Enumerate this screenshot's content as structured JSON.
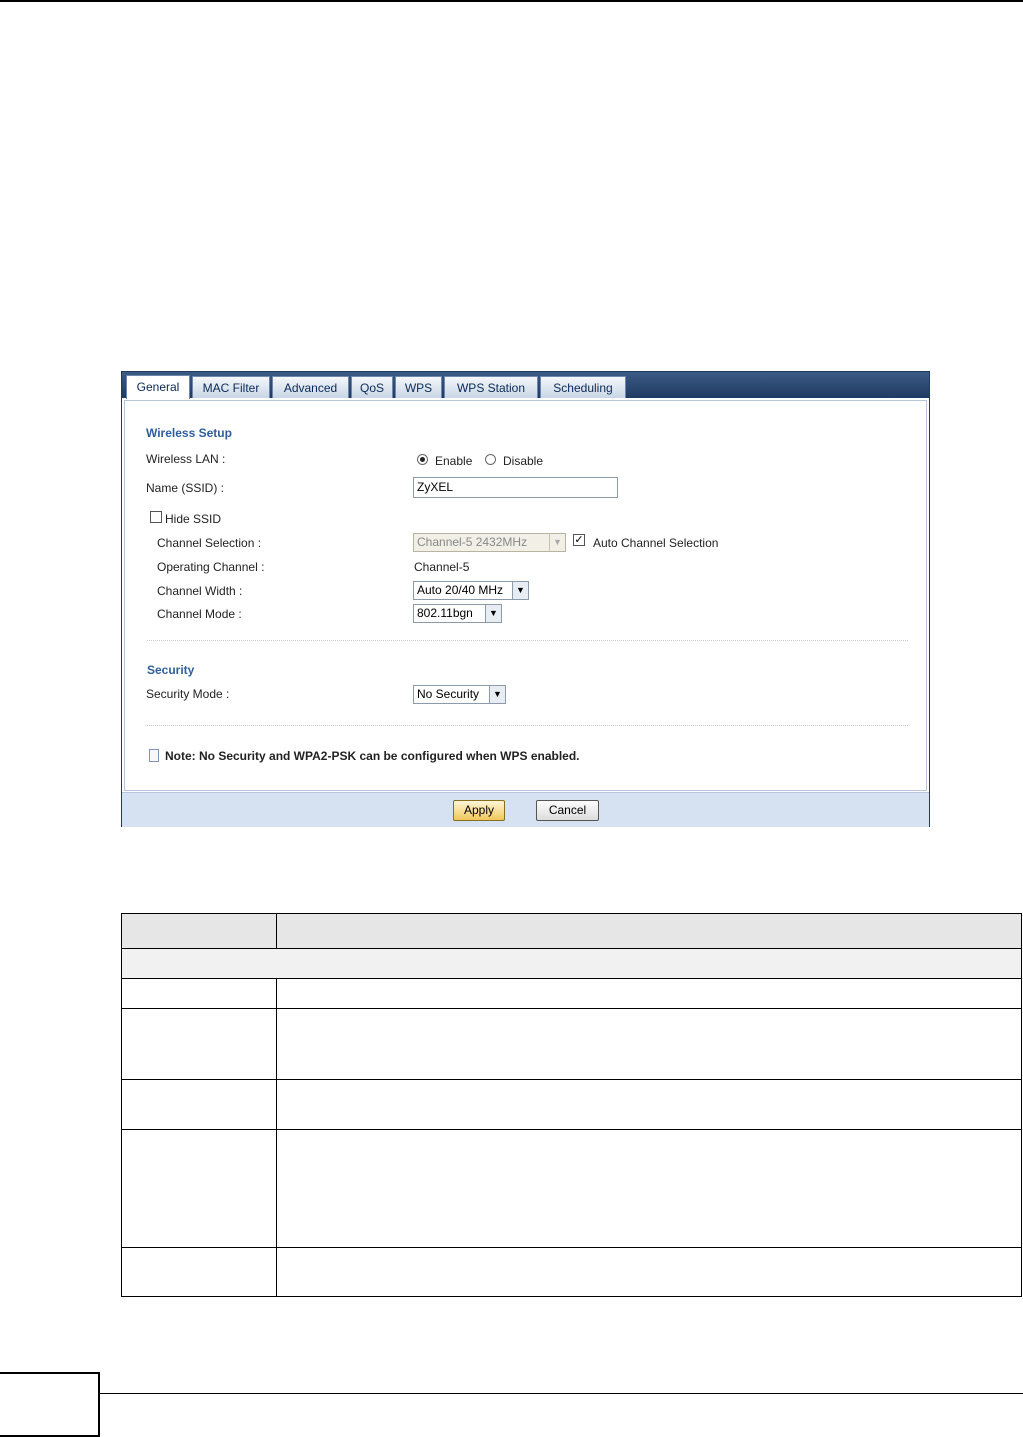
{
  "tabs": [
    {
      "label": "General",
      "active": true
    },
    {
      "label": "MAC Filter",
      "active": false
    },
    {
      "label": "Advanced",
      "active": false
    },
    {
      "label": "QoS",
      "active": false
    },
    {
      "label": "WPS",
      "active": false
    },
    {
      "label": "WPS Station",
      "active": false
    },
    {
      "label": "Scheduling",
      "active": false
    }
  ],
  "wireless_setup": {
    "title": "Wireless Setup",
    "wlan_label": "Wireless LAN :",
    "enable_label": "Enable",
    "disable_label": "Disable",
    "wlan_value": "Enable",
    "ssid_label": "Name (SSID) :",
    "ssid_value": "ZyXEL",
    "hide_ssid_label": "Hide SSID",
    "hide_ssid_checked": false,
    "channel_selection_label": "Channel Selection :",
    "channel_selection_value": "Channel-5 2432MHz",
    "auto_channel_label": "Auto Channel Selection",
    "auto_channel_checked": true,
    "operating_channel_label": "Operating Channel :",
    "operating_channel_value": "Channel-5",
    "channel_width_label": "Channel Width :",
    "channel_width_value": "Auto 20/40 MHz",
    "channel_mode_label": "Channel Mode :",
    "channel_mode_value": "802.11bgn"
  },
  "security": {
    "title": "Security",
    "mode_label": "Security Mode :",
    "mode_value": "No Security"
  },
  "note": "Note: No Security and WPA2-PSK can be configured when WPS enabled.",
  "buttons": {
    "apply": "Apply",
    "cancel": "Cancel"
  },
  "colors": {
    "tabbar": "#203b63",
    "section_title": "#2f5f9b",
    "footer": "#d6e2f1"
  }
}
